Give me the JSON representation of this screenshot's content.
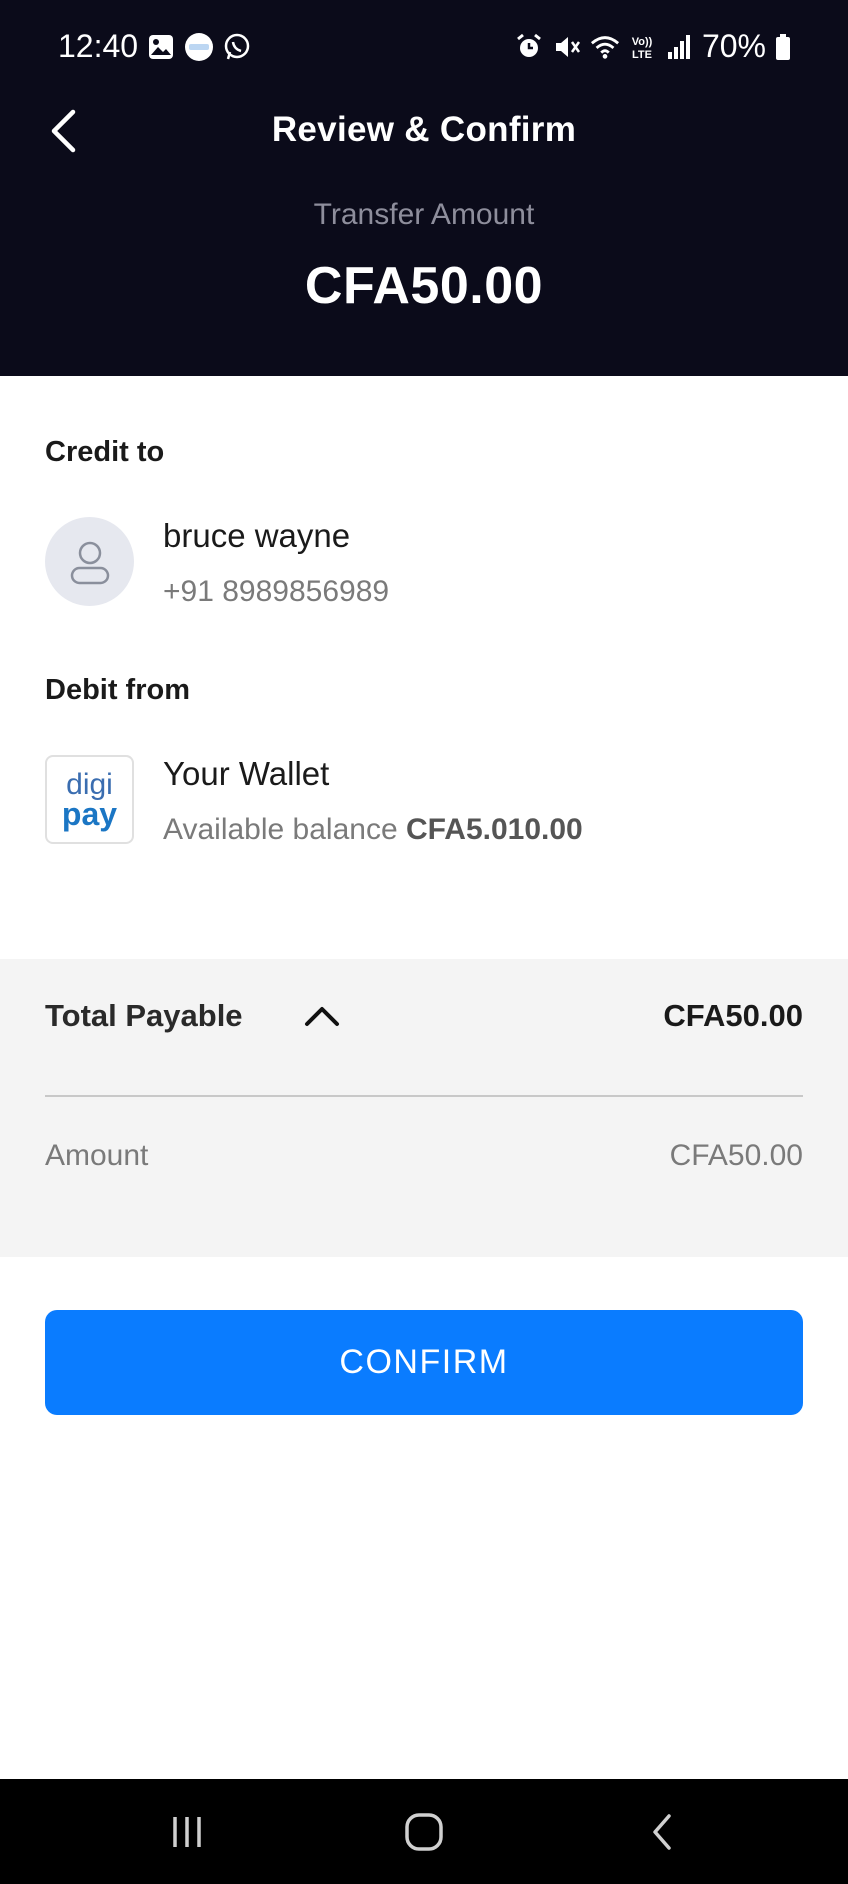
{
  "status_bar": {
    "time": "12:40",
    "battery": "70%",
    "left_icons": [
      "gallery-icon",
      "digipay-app-icon",
      "whatsapp-icon"
    ],
    "right_icons": [
      "alarm-icon",
      "mute-icon",
      "wifi-icon",
      "volte-icon",
      "signal-icon",
      "battery-icon"
    ],
    "volte_label": "Vo)) LTE"
  },
  "header": {
    "title": "Review & Confirm",
    "amount_label": "Transfer Amount",
    "amount_value": "CFA50.00",
    "background": "#0b0b1a"
  },
  "credit": {
    "label": "Credit to",
    "name": "bruce wayne",
    "phone": "+91 8989856989"
  },
  "debit": {
    "label": "Debit from",
    "logo_top": "digi",
    "logo_bottom": "pay",
    "wallet_name": "Your Wallet",
    "balance_prefix": "Available balance",
    "balance_value": "CFA5.010.00"
  },
  "summary": {
    "total_label": "Total Payable",
    "total_value": "CFA50.00",
    "expanded": true,
    "items": [
      {
        "label": "Amount",
        "value": "CFA50.00"
      }
    ]
  },
  "actions": {
    "confirm_label": "CONFIRM",
    "accent": "#0a7cff"
  },
  "nav_bar": {
    "buttons": [
      "recents-icon",
      "home-icon",
      "back-icon"
    ]
  }
}
